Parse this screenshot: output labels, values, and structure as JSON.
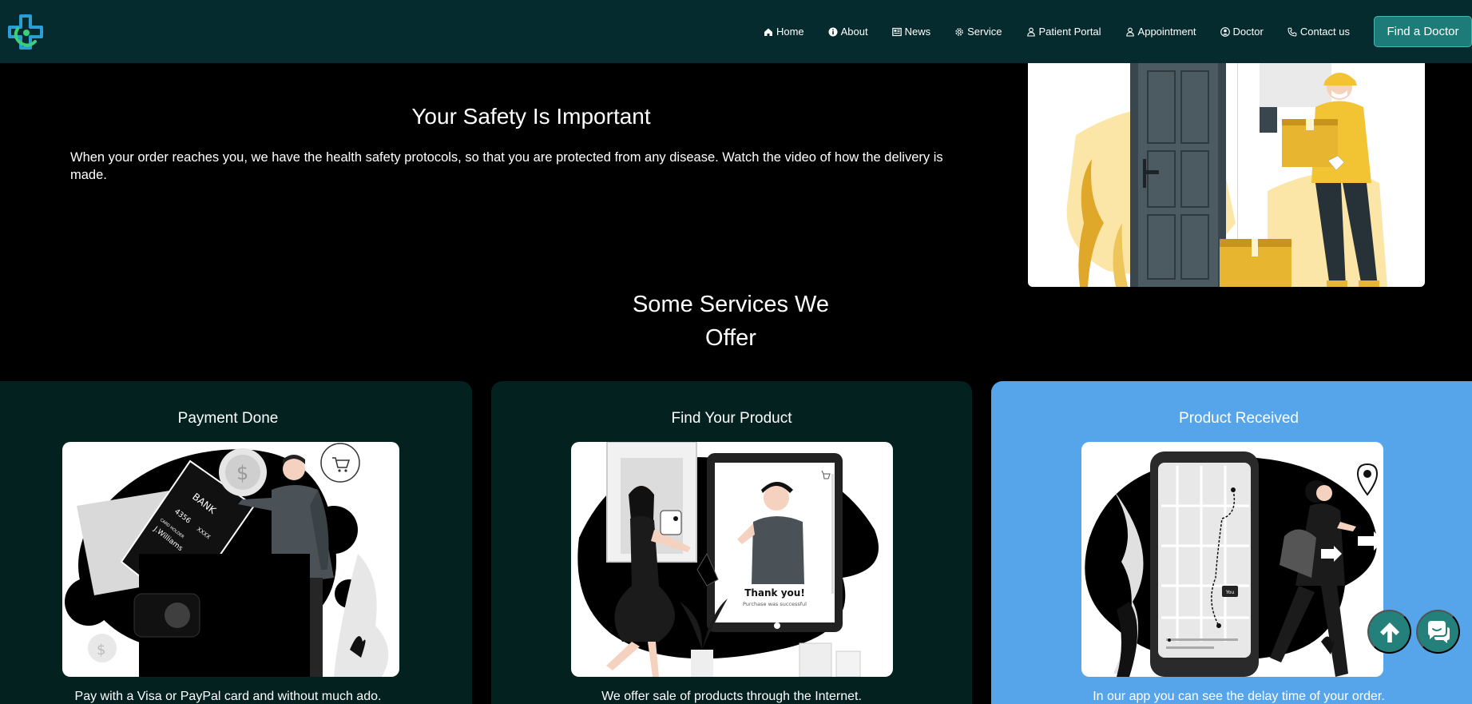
{
  "nav": {
    "items": [
      {
        "label": "Home",
        "icon": "home-icon"
      },
      {
        "label": "About",
        "icon": "info-icon"
      },
      {
        "label": "News",
        "icon": "newspaper-icon"
      },
      {
        "label": "Service",
        "icon": "gear-icon"
      },
      {
        "label": "Patient Portal",
        "icon": "person-icon"
      },
      {
        "label": "Appointment",
        "icon": "person-icon"
      },
      {
        "label": "Doctor",
        "icon": "user-circle-icon"
      },
      {
        "label": "Contact us",
        "icon": "phone-icon"
      }
    ],
    "cta_label": "Find a Doctor"
  },
  "hero": {
    "title": "Your Safety Is Important",
    "text": "When your order reaches you, we have the health safety protocols, so that you are protected from any disease. Watch the video of how the delivery is made."
  },
  "services": {
    "title_line1": "Some Services We",
    "title_line2": "Offer",
    "cards": [
      {
        "title": "Payment Done",
        "description": "Pay with a Visa or PayPal card and without much ado."
      },
      {
        "title": "Find Your Product",
        "description": "We offer sale of products through the Internet."
      },
      {
        "title": "Product Received",
        "description": "In our app you can see the delay time of your order."
      }
    ]
  },
  "illustration_text": {
    "bank": "BANK",
    "card_number": "4356",
    "card_holder_label": "CARD HOLDER",
    "card_holder_name": "J.Williams",
    "card_mask": "XXXX",
    "thank_you": "Thank you!",
    "purchase_msg": "Purchase was successful",
    "you_label": "You"
  },
  "colors": {
    "navbar_bg": "#062b2e",
    "card_dark": "#03211f",
    "card_accent": "#56a5ea",
    "button_teal": "#23807a"
  }
}
